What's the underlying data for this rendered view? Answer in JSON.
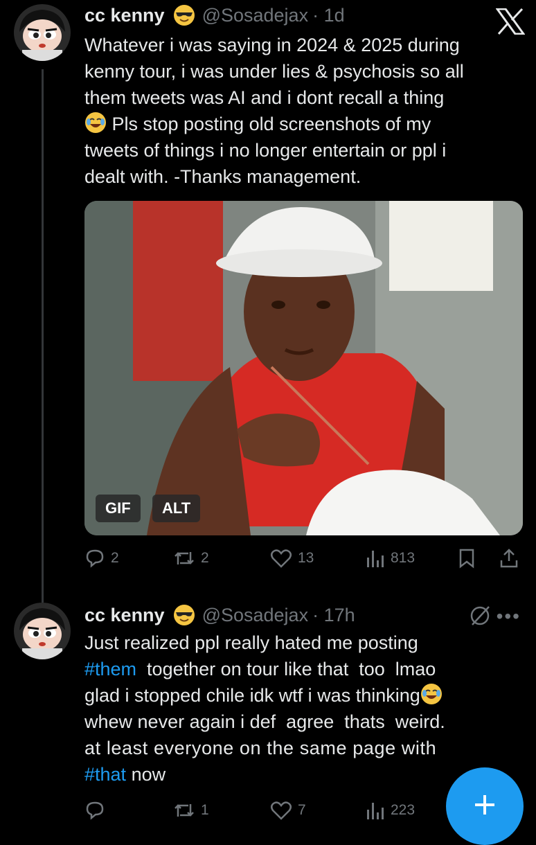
{
  "tweets": [
    {
      "name": "cc kenny",
      "handle": "@Sosadejax",
      "time": "· 1d",
      "lines": [
        "Whatever i was saying in 2024 & 2025 during",
        "kenny tour, i was under lies & psychosis so all",
        "them tweets was AI and i dont recall a thing",
        " Pls stop posting old screenshots of my",
        "tweets of things i no longer entertain or ppl i",
        "dealt with. -Thanks management."
      ],
      "media": {
        "gif_label": "GIF",
        "alt_label": "ALT"
      },
      "actions": {
        "replies": "2",
        "reposts": "2",
        "likes": "13",
        "views": "813"
      }
    },
    {
      "name": "cc kenny",
      "handle": "@Sosadejax",
      "time": "· 17h",
      "line1": "Just realized ppl really hated  me  posting",
      "line2_tag": "#them",
      "line2_rest": "  together on tour like that  too  lmao",
      "line3": "glad i stopped chile idk wtf i was thinking",
      "line4": "whew never again i def  agree  thats  weird.",
      "line5": "at least everyone on the same page with",
      "line6_tag": "#that",
      "line6_rest": " now",
      "actions": {
        "replies": "",
        "reposts": "1",
        "likes": "7",
        "views": "223"
      }
    }
  ],
  "icons": {
    "app_logo": "x-logo-icon",
    "more": "more-icon",
    "compose": "plus-icon",
    "grok": "slash-circle-icon"
  },
  "colors": {
    "accent": "#1d9bf0",
    "muted": "#71767b",
    "text": "#e7e9ea"
  }
}
